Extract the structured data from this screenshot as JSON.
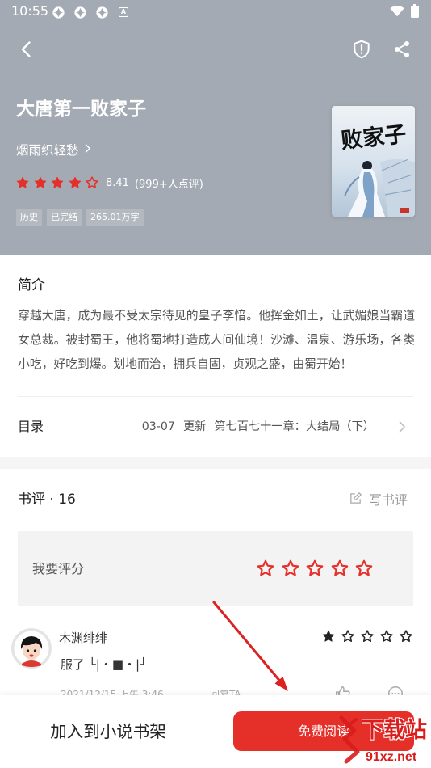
{
  "colors": {
    "accent": "#e5302a",
    "header_bg": "#a4aab3",
    "review_star": "#222222",
    "watermark": "#d91c1c"
  },
  "status_bar": {
    "time": "10:55",
    "badge": "A",
    "icons": [
      "app-notification-icon",
      "app-notification-icon",
      "app-notification-icon",
      "a-badge-icon",
      "wifi-icon",
      "battery-icon"
    ]
  },
  "nav": {
    "icons": [
      "back-arrow-icon",
      "shield-alert-icon",
      "share-icon"
    ]
  },
  "book": {
    "title": "大唐第一败家子",
    "author": "烟雨织轻愁",
    "stars_filled": 4,
    "stars_total": 5,
    "rating": "8.41",
    "review_count": "(999+人点评)",
    "tags": [
      "历史",
      "已完结",
      "265.01万字"
    ],
    "cover_title": "败家子"
  },
  "intro": {
    "heading": "简介",
    "text": "穿越大唐，成为最不受太宗待见的皇子李愔。他挥金如土，让武媚娘当霸道女总裁。被封蜀王，他将蜀地打造成人间仙境！沙滩、温泉、游乐场，各类小吃，好吃到爆。划地而治，拥兵自固，贞观之盛，由蜀开始！"
  },
  "catalog": {
    "label": "目录",
    "date": "03-07",
    "update_label": "更新",
    "latest_chapter": "第七百七十一章：大结局（下）"
  },
  "reviews": {
    "heading": "书评 · 16",
    "write_label": "写书评",
    "rate_prompt": "我要评分",
    "rate_stars_filled": 0,
    "rate_stars_total": 5,
    "items": [
      {
        "name": "木渊绯绯",
        "stars_filled": 1,
        "stars_total": 5,
        "text": "服了 └|・■・|┘",
        "time": "2021/12/15 上午 3:46",
        "reply_label": "回复TA"
      }
    ]
  },
  "bottom_bar": {
    "shelf_label": "加入到小说书架",
    "read_label": "免费阅读"
  },
  "watermark": {
    "main": "下载站",
    "url": "91xz.net"
  }
}
